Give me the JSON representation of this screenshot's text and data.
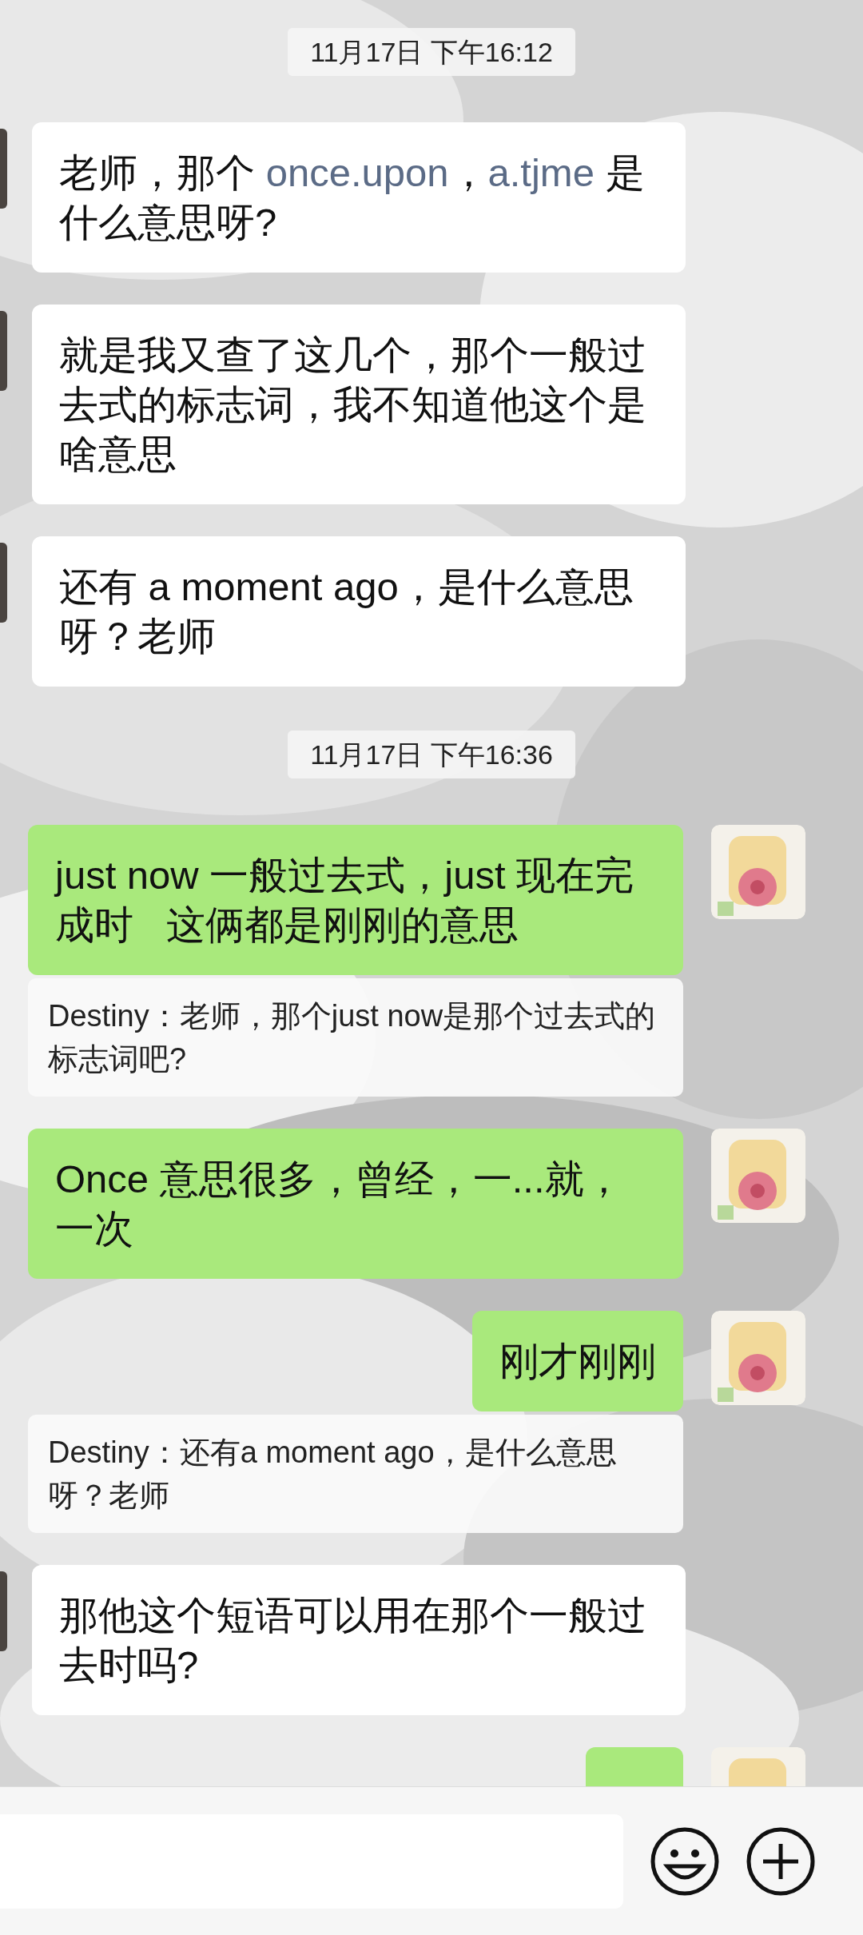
{
  "messages": [
    {
      "kind": "time",
      "text": "11月17日 下午16:12"
    },
    {
      "kind": "incoming",
      "parts": [
        {
          "kind": "plain",
          "text": "老师，那个 "
        },
        {
          "kind": "link",
          "text": "once.upon"
        },
        {
          "kind": "plain",
          "text": "，"
        },
        {
          "kind": "link",
          "text": "a.tjme"
        },
        {
          "kind": "plain",
          "text": " 是什么意思呀?"
        }
      ]
    },
    {
      "kind": "incoming",
      "parts": [
        {
          "kind": "plain",
          "text": "就是我又查了这几个，那个一般过去式的标志词，我不知道他这个是啥意思"
        }
      ]
    },
    {
      "kind": "incoming",
      "parts": [
        {
          "kind": "plain",
          "text": "还有 a moment ago，是什么意思呀？老师"
        }
      ]
    },
    {
      "kind": "time",
      "text": "11月17日 下午16:36"
    },
    {
      "kind": "outgoing",
      "text": "just now 一般过去式，just 现在完成时   这俩都是刚刚的意思"
    },
    {
      "kind": "quote",
      "text": "Destiny：老师，那个just now是那个过去式的标志词吧?"
    },
    {
      "kind": "outgoing",
      "text": "Once 意思很多，曾经，一...就，一次"
    },
    {
      "kind": "outgoing",
      "text": "刚才刚刚"
    },
    {
      "kind": "quote",
      "text": "Destiny：还有a moment ago，是什么意思呀？老师"
    },
    {
      "kind": "incoming",
      "parts": [
        {
          "kind": "plain",
          "text": "那他这个短语可以用在那个一般过去时吗?"
        }
      ]
    },
    {
      "kind": "clipped"
    }
  ]
}
